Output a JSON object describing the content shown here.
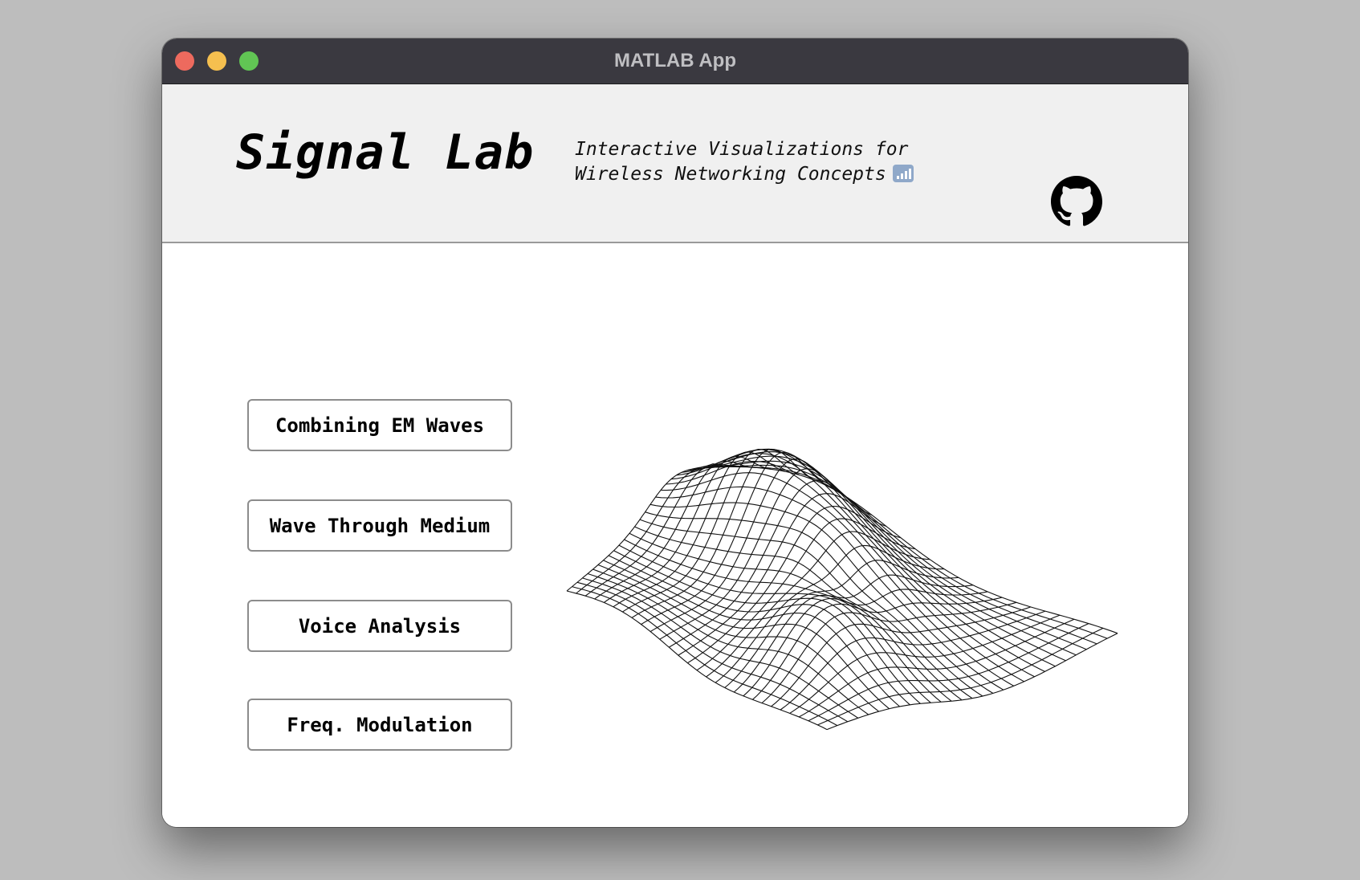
{
  "window": {
    "title": "MATLAB App"
  },
  "header": {
    "title": "Signal Lab",
    "subtitle_line1": "Interactive Visualizations for",
    "subtitle_line2": "Wireless Networking Concepts",
    "subtitle_icon": "signal-bars-icon",
    "repo_icon": "github-icon"
  },
  "nav": {
    "buttons": [
      {
        "label": "Combining EM Waves"
      },
      {
        "label": "Wave Through Medium"
      },
      {
        "label": "Voice Analysis"
      },
      {
        "label": "Freq. Modulation"
      }
    ]
  },
  "illustration": {
    "icon": "wireframe-surface-icon"
  },
  "colors": {
    "titlebar": "#3a3940",
    "header_bg": "#f0f0f0",
    "close": "#ed6a5e",
    "minimize": "#f5bf4f",
    "maximize": "#61c554"
  }
}
